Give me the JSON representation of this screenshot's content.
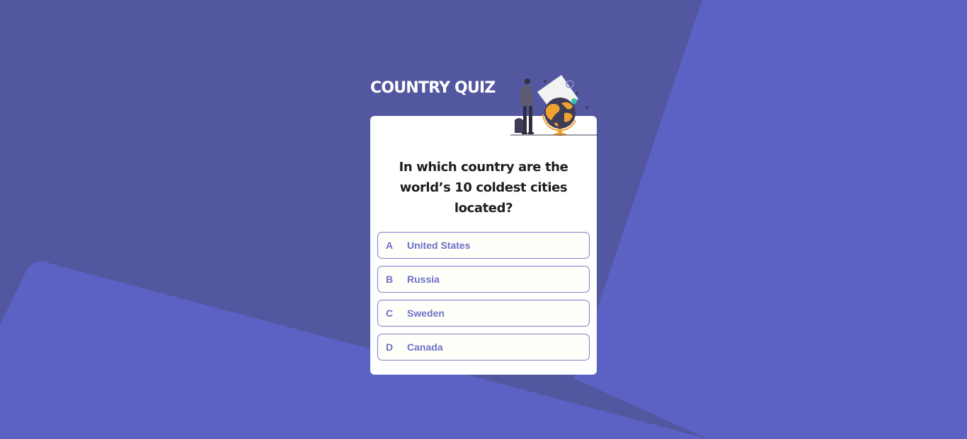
{
  "app": {
    "title": "COUNTRY QUIZ"
  },
  "question": {
    "text": "In which country are the world’s 10 coldest cities located?"
  },
  "options": [
    {
      "letter": "A",
      "label": "United States"
    },
    {
      "letter": "B",
      "label": "Russia"
    },
    {
      "letter": "C",
      "label": "Sweden"
    },
    {
      "letter": "D",
      "label": "Canada"
    }
  ],
  "colors": {
    "background": "#52579f",
    "background_shape": "#5c62c3",
    "option_text": "#6c70c7",
    "option_border": "#7c80c8",
    "globe_accent": "#f1a12e"
  },
  "icons": {
    "header_illustration": "traveler-with-globe-illustration"
  }
}
